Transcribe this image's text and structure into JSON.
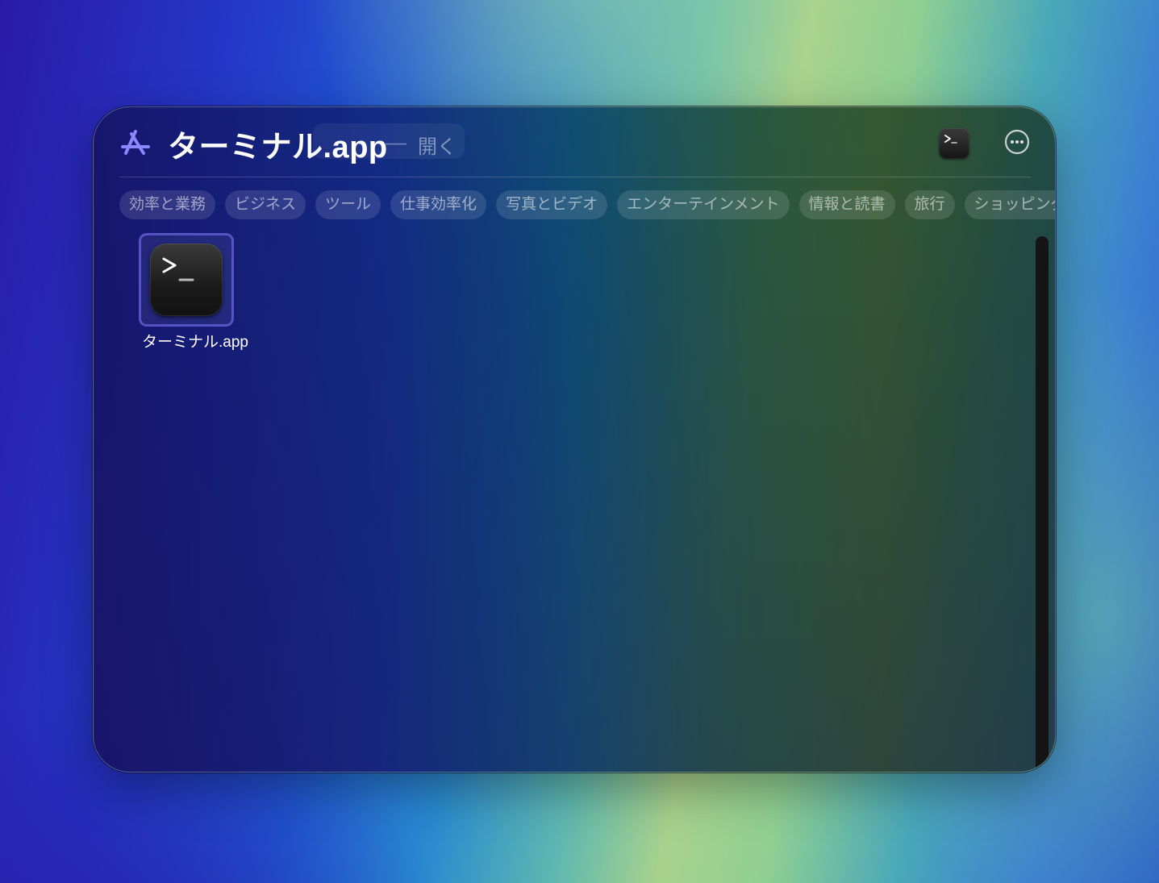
{
  "header": {
    "app_icon": "app-store-icon",
    "title": "ターミナル.app",
    "separator": "—",
    "action_label": "開く",
    "action_icon": "terminal-icon",
    "more_icon": "ellipsis-circle-icon"
  },
  "categories": [
    "効率と業務",
    "ビジネス",
    "ツール",
    "仕事効率化",
    "写真とビデオ",
    "エンターテインメント",
    "情報と読書",
    "旅行",
    "ショッピングと食事"
  ],
  "results": [
    {
      "name": "ターミナル.app",
      "icon": "terminal-icon",
      "selected": true
    }
  ],
  "colors": {
    "selection_border": "#8278ff",
    "text_primary": "#ffffff"
  }
}
